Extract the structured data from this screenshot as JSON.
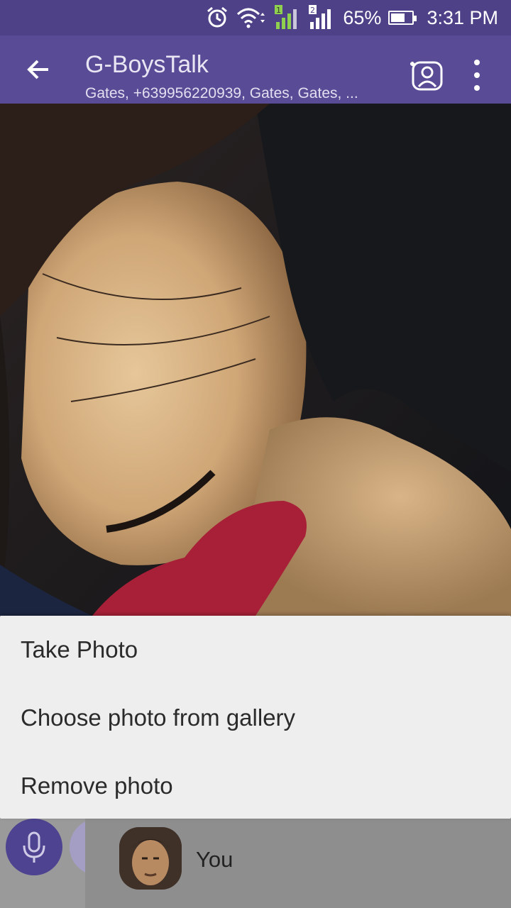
{
  "status_bar": {
    "battery_percent": "65%",
    "time": "3:31 PM",
    "battery_level": 0.65,
    "icons": [
      "alarm-icon",
      "wifi-icon",
      "signal-sim1-icon",
      "signal-sim2-icon",
      "battery-icon"
    ]
  },
  "app_bar": {
    "title": "G-BoysTalk",
    "subtitle": "Gates, +639956220939, Gates, Gates, ..."
  },
  "sheet": {
    "items": [
      {
        "label": "Take Photo"
      },
      {
        "label": "Choose photo from gallery"
      },
      {
        "label": "Remove photo"
      }
    ]
  },
  "participants": {
    "self_label": "You"
  },
  "colors": {
    "status_bar": "#4e4187",
    "app_bar": "#5a4b96",
    "accent": "#4d4391",
    "sheet_bg": "#eeeeee"
  }
}
